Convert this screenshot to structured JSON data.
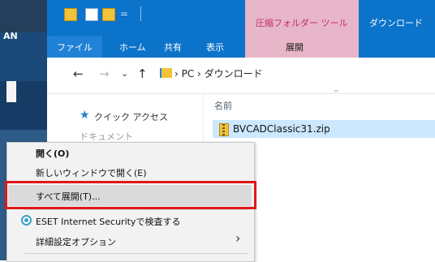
{
  "desktop": {
    "label": "AN"
  },
  "window": {
    "title": "ダウンロード",
    "context_tab_group": "圧縮フォルダー ツール",
    "ribbon_tabs": [
      "ファイル",
      "ホーム",
      "共有",
      "表示",
      "展開"
    ],
    "qat_separator": "="
  },
  "address": {
    "back": "←",
    "forward": "→",
    "recent": "⌄",
    "up": "↑",
    "path": "› PC › ダウンロード"
  },
  "navpane": {
    "quick_access": "クイック アクセス",
    "documents": "ドキュメント"
  },
  "file_list": {
    "column_name": "名前",
    "sort_caret": "^",
    "files": [
      "BVCADClassic31.zip"
    ]
  },
  "context_menu": {
    "items": [
      "開く(O)",
      "新しいウィンドウで開く(E)",
      "すべて展開(T)...",
      "ESET Internet Securityで検査する",
      "詳細設定オプション"
    ],
    "submenu_arrow": "›",
    "highlighted_item": "すべて展開(T)..."
  },
  "colors": {
    "ribbon_blue": "#0b73c9",
    "context_tab_pink": "#e7b6c8",
    "selection_blue": "#cce8ff",
    "highlight_red": "#e01818"
  }
}
